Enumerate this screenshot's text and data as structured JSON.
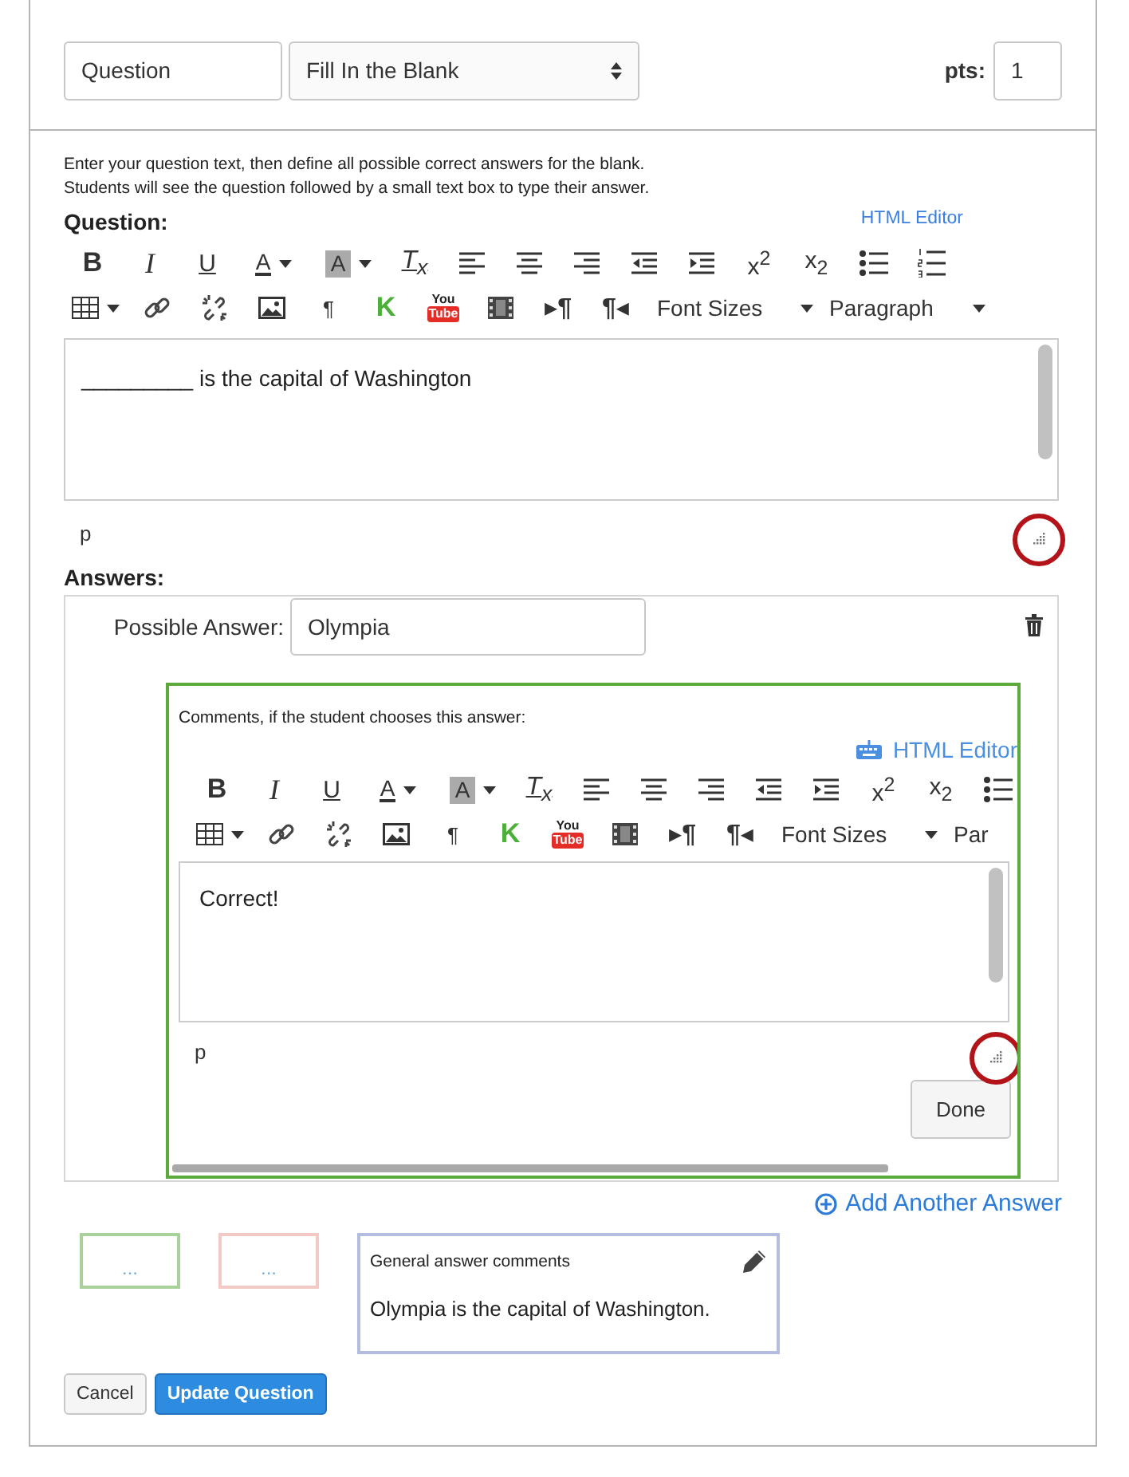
{
  "question_header": {
    "title_field": {
      "value": "Question"
    },
    "type_select": {
      "value": "Fill In the Blank"
    },
    "points": {
      "label": "pts:",
      "value": "1"
    }
  },
  "instructions": [
    "Enter your question text, then define all possible correct answers for the blank.",
    "Students will see the question followed by a small text box to type their answer."
  ],
  "question_editor": {
    "label": "Question:",
    "html_editor_link": {
      "label": "HTML Editor",
      "with_icon": false
    },
    "toolbar_rows": [
      [
        {
          "kind": "bold",
          "label": "B"
        },
        {
          "kind": "italic",
          "label": "I"
        },
        {
          "kind": "underline",
          "label": "U"
        },
        {
          "kind": "text-color",
          "label": "A"
        },
        {
          "kind": "highlight",
          "label": "A"
        },
        {
          "kind": "clear-format",
          "label": "T$_{x}$"
        },
        {
          "kind": "align-left"
        },
        {
          "kind": "align-center"
        },
        {
          "kind": "align-right"
        },
        {
          "kind": "outdent"
        },
        {
          "kind": "indent"
        },
        {
          "kind": "superscript",
          "label": "x$^{2}$"
        },
        {
          "kind": "subscript",
          "label": "x$_{2}$"
        },
        {
          "kind": "bullet-list"
        },
        {
          "kind": "numbered-list"
        }
      ],
      [
        {
          "kind": "table"
        },
        {
          "kind": "link"
        },
        {
          "kind": "unlink"
        },
        {
          "kind": "image"
        },
        {
          "kind": "pilcrow",
          "label": "¶"
        },
        {
          "kind": "k-logo",
          "label": "K"
        },
        {
          "kind": "youtube",
          "lines": [
            "You",
            "Tube"
          ]
        },
        {
          "kind": "film"
        },
        {
          "kind": "ltr",
          "label": "▸¶"
        },
        {
          "kind": "rtl",
          "label": "¶◂"
        },
        {
          "kind": "dropdown",
          "label": "Font Sizes"
        },
        {
          "kind": "dropdown",
          "label": "Paragraph"
        }
      ]
    ],
    "content": "_________ is the capital of Washington",
    "path": "p",
    "resize_circled": true
  },
  "answers": {
    "label": "Answers:",
    "items": [
      {
        "label": "Possible Answer:",
        "value": "Olympia",
        "comments": {
          "prompt": "Comments, if the student chooses this answer:",
          "html_editor_link": {
            "label": "HTML Editor",
            "with_icon": true
          },
          "toolbar_rows": [
            [
              {
                "kind": "bold",
                "label": "B"
              },
              {
                "kind": "italic",
                "label": "I"
              },
              {
                "kind": "underline",
                "label": "U"
              },
              {
                "kind": "text-color",
                "label": "A"
              },
              {
                "kind": "highlight",
                "label": "A"
              },
              {
                "kind": "clear-format",
                "label": "T$_{x}$"
              },
              {
                "kind": "align-left"
              },
              {
                "kind": "align-center"
              },
              {
                "kind": "align-right"
              },
              {
                "kind": "outdent"
              },
              {
                "kind": "indent"
              },
              {
                "kind": "superscript",
                "label": "x$^{2}$"
              },
              {
                "kind": "subscript",
                "label": "x$_{2}$"
              },
              {
                "kind": "bullet-list"
              }
            ],
            [
              {
                "kind": "table"
              },
              {
                "kind": "link"
              },
              {
                "kind": "unlink"
              },
              {
                "kind": "image"
              },
              {
                "kind": "pilcrow",
                "label": "¶"
              },
              {
                "kind": "k-logo",
                "label": "K"
              },
              {
                "kind": "youtube",
                "lines": [
                  "You",
                  "Tube"
                ]
              },
              {
                "kind": "film"
              },
              {
                "kind": "ltr",
                "label": "▸¶"
              },
              {
                "kind": "rtl",
                "label": "¶◂"
              },
              {
                "kind": "dropdown",
                "label": "Font Sizes"
              },
              {
                "kind": "dropdown-cut",
                "label": "Par"
              }
            ]
          ],
          "content": "Correct!",
          "path": "p",
          "resize_circled": true,
          "done_button": "Done"
        }
      }
    ],
    "add_link": "Add Another Answer"
  },
  "comment_bubbles": [
    {
      "kind": "correct",
      "text": "..."
    },
    {
      "kind": "incorrect",
      "text": "..."
    },
    {
      "kind": "general",
      "title": "General answer comments",
      "text": "Olympia is the capital of Washington."
    }
  ],
  "buttons": [
    {
      "kind": "secondary",
      "label": "Cancel"
    },
    {
      "kind": "primary",
      "label": "Update Question"
    }
  ]
}
